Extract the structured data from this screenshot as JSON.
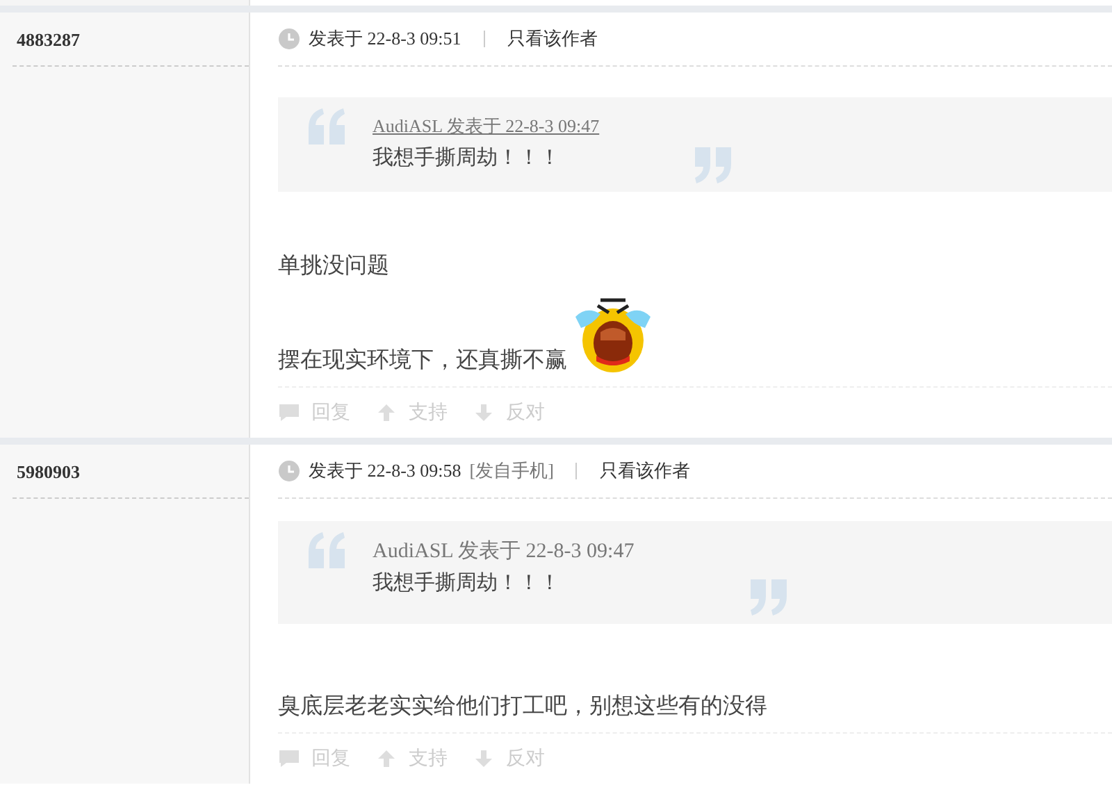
{
  "posts": [
    {
      "author_id": "4883287",
      "posted": "发表于 22-8-3 09:51",
      "author_only": "只看该作者",
      "quote": {
        "meta": "AudiASL 发表于 22-8-3 09:47",
        "linked": true,
        "text": "我想手撕周劫！！！"
      },
      "paragraphs": [
        {
          "text": "单挑没问题",
          "emoji": false
        },
        {
          "text": "摆在现实环境下，还真撕不赢",
          "emoji": true
        }
      ],
      "actions": [
        "回复",
        "支持",
        "反对"
      ]
    },
    {
      "author_id": "5980903",
      "posted": "发表于 22-8-3 09:58",
      "source": "[发自手机]",
      "author_only": "只看该作者",
      "quote": {
        "meta": "AudiASL 发表于 22-8-3 09:47",
        "linked": false,
        "text": "我想手撕周劫！！！"
      },
      "paragraphs": [
        {
          "text": "臭底层老老实实给他们打工吧，别想这些有的没得",
          "emoji": false
        }
      ],
      "actions": [
        "回复",
        "支持",
        "反对"
      ]
    }
  ]
}
